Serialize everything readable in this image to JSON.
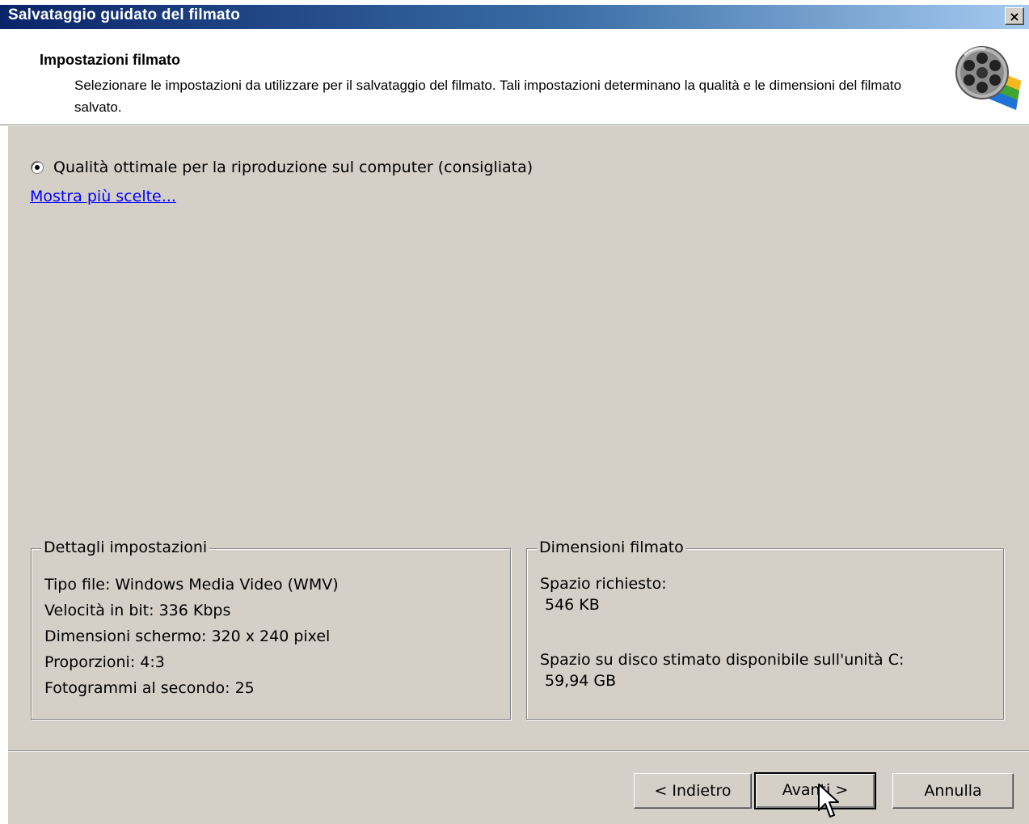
{
  "window": {
    "title": "Salvataggio guidato del filmato",
    "close_label": "×"
  },
  "header": {
    "title": "Impostazioni filmato",
    "description": "Selezionare le impostazioni da utilizzare per il salvataggio del filmato. Tali impostazioni determinano la qualità e le dimensioni del filmato salvato.",
    "logo_icon": "film-reel-icon"
  },
  "options": {
    "selected_label": "Qualità ottimale per la riproduzione sul computer (consigliata)",
    "more_link": "Mostra più scelte..."
  },
  "settings_details": {
    "legend": "Dettagli impostazioni",
    "lines": [
      "Tipo file: Windows Media Video (WMV)",
      "Velocità in bit: 336 Kbps",
      "Dimensioni schermo: 320 x 240 pixel",
      "Proporzioni: 4:3",
      "Fotogrammi al secondo: 25"
    ]
  },
  "movie_size": {
    "legend": "Dimensioni filmato",
    "required_label": "Spazio richiesto:",
    "required_value": "546 KB",
    "available_label": "Spazio su disco stimato disponibile sull'unità C:",
    "available_value": "59,94 GB"
  },
  "buttons": {
    "back": "< Indietro",
    "next": "Avanti >",
    "cancel": "Annulla"
  },
  "colors": {
    "dialog_bg": "#d4d0c8",
    "titlebar_start": "#0a246a",
    "titlebar_end": "#a6caf0",
    "link": "#0000ff"
  }
}
